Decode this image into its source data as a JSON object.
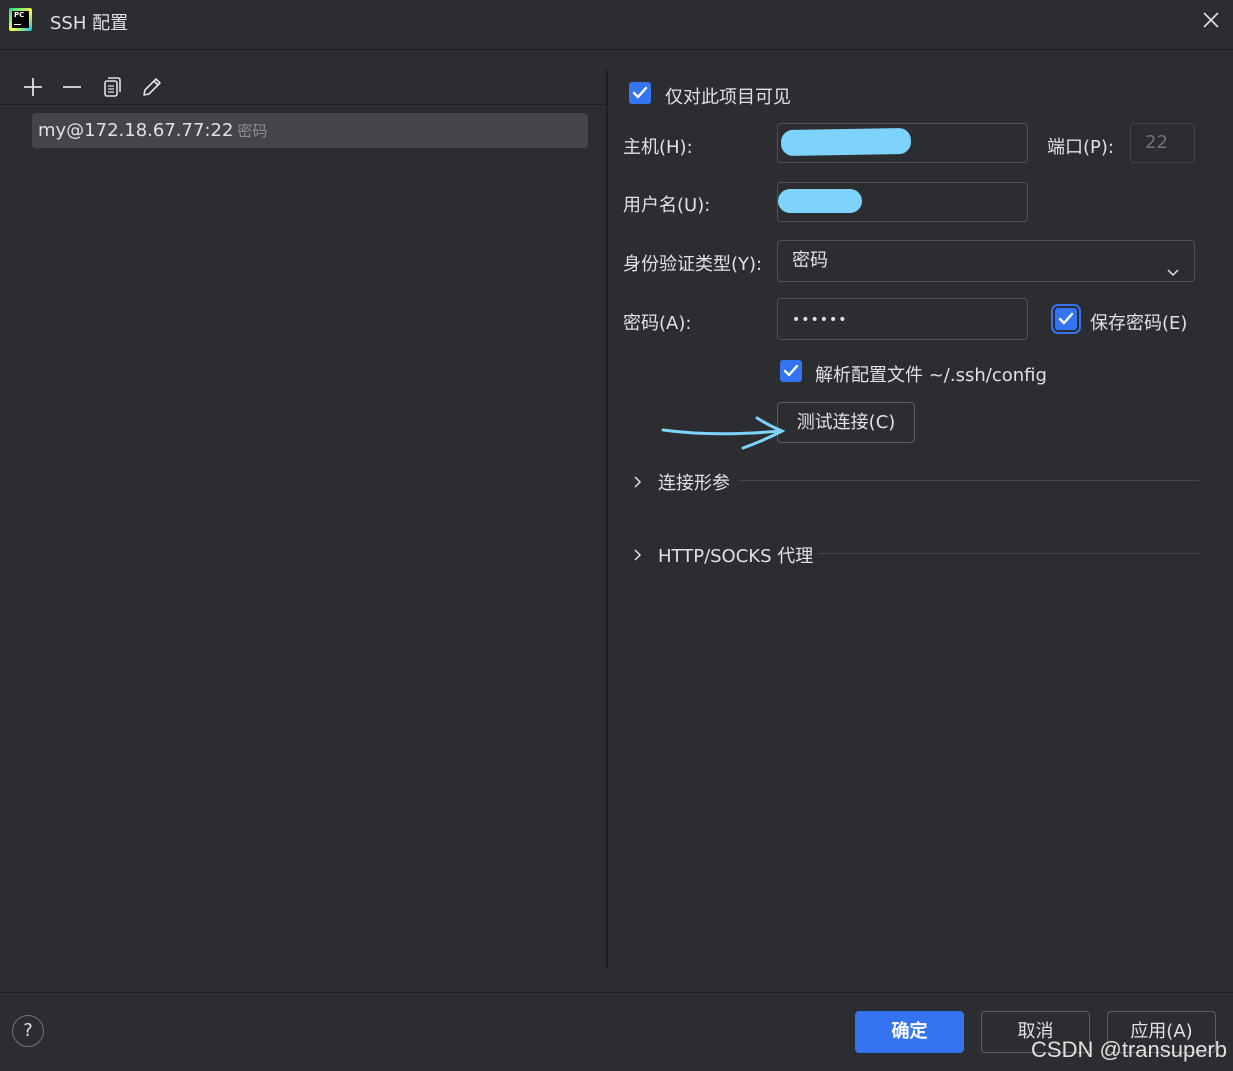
{
  "window": {
    "title": "SSH 配置",
    "logo_text": "PC"
  },
  "toolbar": {
    "add_icon": "plus-icon",
    "remove_icon": "minus-icon",
    "copy_icon": "copy-icon",
    "edit_icon": "pencil-icon"
  },
  "list": {
    "items": [
      {
        "host": "my@172.18.67.77:22",
        "auth": "密码"
      }
    ]
  },
  "form": {
    "visible_only_label": "仅对此项目可见",
    "host_label": "主机(H):",
    "port_label": "端口(P):",
    "port_value": "22",
    "username_label": "用户名(U):",
    "auth_type_label": "身份验证类型(Y):",
    "auth_type_value": "密码",
    "password_label": "密码(A):",
    "password_value": "••••••",
    "save_password_label": "保存密码(E)",
    "parse_config_label": "解析配置文件 ~/.ssh/config",
    "test_connection_label": "测试连接(C)"
  },
  "sections": {
    "connection_params": "连接形参",
    "proxy": "HTTP/SOCKS 代理"
  },
  "footer": {
    "help": "?",
    "ok": "确定",
    "cancel": "取消",
    "apply": "应用(A)"
  },
  "watermark": "CSDN @transuperb",
  "colors": {
    "accent": "#3574f0",
    "background": "#2b2d30",
    "redaction": "#7dd3fc"
  }
}
